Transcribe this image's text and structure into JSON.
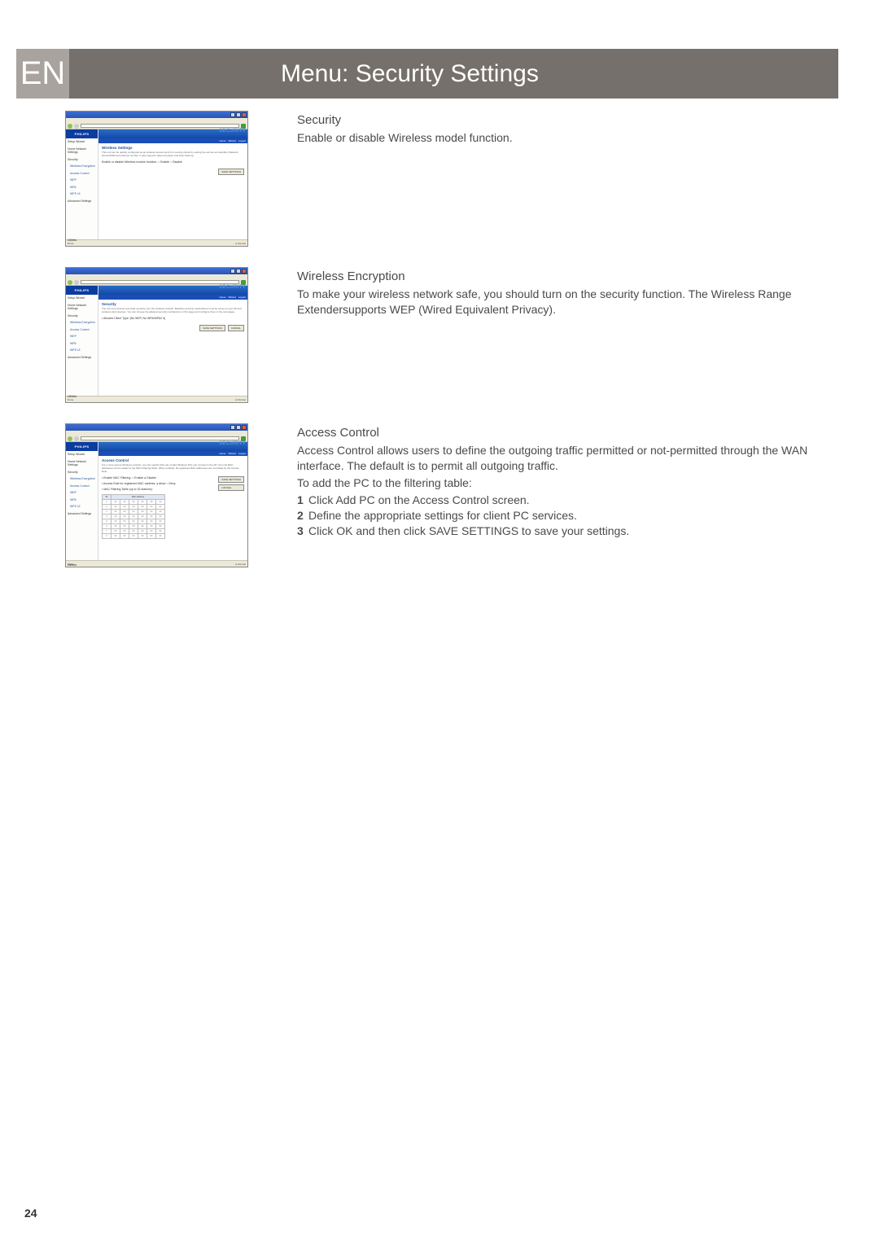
{
  "lang_code": "EN",
  "page_title": "Menu: Security Settings",
  "page_number": "24",
  "sections": [
    {
      "heading": "Security",
      "body": "Enable or disable Wireless model function.",
      "screenshot": {
        "logo": "PHILIPS",
        "ghost": "SECURITY",
        "banner_links": [
          "Home",
          "Wizard",
          "Logout"
        ],
        "nav": [
          "Setup Wizard",
          "Home Network Settings",
          "Security",
          "Wireless Encryption",
          "Access Control",
          "WEP",
          "WPA",
          "WPS UI",
          "Advanced Settings",
          "Utilities"
        ],
        "main_title": "Wireless Settings",
        "main_desc": "This unit can be quickly configured as an wireless access point for roaming clients by setting the service set identifier (Network Name/SSID) and channel number. It also supports data encryption and client filtering.",
        "main_line": "Enable or disable Wireless module function:   ○ Enable  ○ Disable",
        "buttons": [
          "SAVE SETTINGS"
        ]
      }
    },
    {
      "heading": "Wireless Encryption",
      "body": "To make your wireless network safe, you should turn on the security function. The Wireless Range Extendersupports WEP (Wired Equivalent Privacy).",
      "screenshot": {
        "logo": "PHILIPS",
        "ghost": "SECURITY",
        "banner_links": [
          "Home",
          "Wizard",
          "Logout"
        ],
        "nav": [
          "Setup Wizard",
          "Home Network Settings",
          "Security",
          "Wireless Encryption",
          "Access Control",
          "WEP",
          "WPA",
          "WPS UI",
          "Advanced Settings",
          "Utilities"
        ],
        "main_title": "Security",
        "main_desc": "The unit can transmit your data securely over the wireless network. Matching security mechanisms must be setup on your AP and wireless client devices. You can choose the allowed security mechanisms in this page and configure them in the sub-pages.",
        "main_line": "• Allowed Client Type:  [No WEP, No WPA/WPA2 ▾]",
        "buttons": [
          "SAVE SETTINGS",
          "CANCEL"
        ]
      }
    },
    {
      "heading": "Access Control",
      "body_lines": [
        "Access Control allows users to define the outgoing traffic permitted or not-permitted through the WAN interface. The default is to permit all outgoing traffic.",
        "To add the PC to the filtering table:"
      ],
      "steps": [
        {
          "num": "1",
          "text": "Click  Add PC  on the Access Control screen."
        },
        {
          "num": "2",
          "text": "Define the appropriate settings for client PC services."
        },
        {
          "num": "3",
          "text": "Click  OK  and then click  SAVE SETTINGS  to save your settings."
        }
      ],
      "screenshot": {
        "logo": "PHILIPS",
        "ghost": "SECURITY",
        "banner_links": [
          "Home",
          "Wizard",
          "Logout"
        ],
        "nav": [
          "Setup Wizard",
          "Home Network Settings",
          "Security",
          "Wireless Encryption",
          "Access Control",
          "WEP",
          "WPA",
          "WPS UI",
          "Advanced Settings",
          "Utilities"
        ],
        "main_title": "Access Control",
        "main_desc": "For a more secure Wireless network, you can specify that only certain Wireless PCs can connect to the AP. Up to 32 MAC addresses can be added to the MAC Filtering Table. When enabled, all registered MAC addresses are controlled by the Access Rule.",
        "line1": "• Enable MAC Filtering:   ○ Enable  ● Disable",
        "line2": "• Access Rule for registered MAC address:   ● Allow  ○ Deny",
        "line3": "• MAC Filtering Table (up to 32 stations):",
        "table_header": [
          "ID",
          "MAC Address"
        ],
        "table_cell": "00",
        "buttons": [
          "SAVE SETTINGS",
          "CANCEL"
        ]
      }
    }
  ]
}
